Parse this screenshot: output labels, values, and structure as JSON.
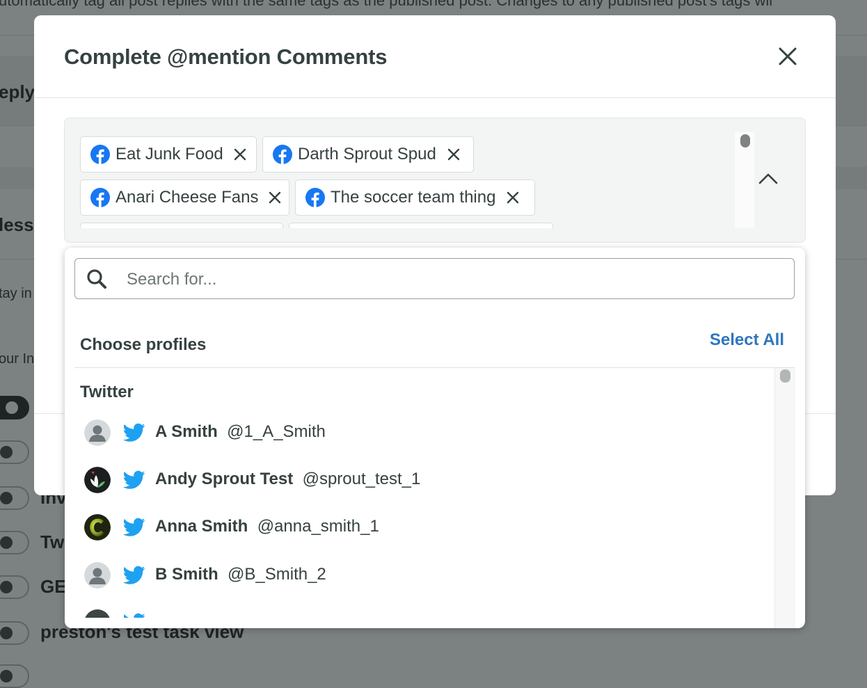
{
  "background": {
    "top_text": "utomatically tag all post replies with the same tags as the published post. Changes to any published post's tags wil",
    "heading_reply": "eply",
    "heading_less": "less",
    "text_stay": "tay in",
    "text_your": "our In",
    "rows": [
      "Inv",
      "Tw",
      "GE",
      "preston's test task view"
    ]
  },
  "modal": {
    "title": "Complete @mention Comments",
    "selected_profiles": [
      {
        "label": "Eat Junk Food",
        "network": "facebook"
      },
      {
        "label": "Darth Sprout Spud",
        "network": "facebook"
      },
      {
        "label": "Anari Cheese Fans",
        "network": "facebook"
      },
      {
        "label": "The soccer team thing",
        "network": "facebook"
      }
    ]
  },
  "dropdown": {
    "search_placeholder": "Search for...",
    "choose_label": "Choose profiles",
    "select_all_label": "Select All",
    "groups": [
      {
        "title": "Twitter",
        "items": [
          {
            "name": "A Smith",
            "handle": "@1_A_Smith",
            "avatar": "default-avatar"
          },
          {
            "name": "Andy Sprout Test",
            "handle": "@sprout_test_1",
            "avatar": "sprout-logo-avatar"
          },
          {
            "name": "Anna Smith",
            "handle": "@anna_smith_1",
            "avatar": "letter-c-avatar"
          },
          {
            "name": "B Smith",
            "handle": "@B_Smith_2",
            "avatar": "default-avatar"
          }
        ]
      }
    ]
  },
  "colors": {
    "overlay": "#7c8181",
    "text": "#364141",
    "link": "#2f76bd",
    "facebook": "#1877f2",
    "twitter": "#1da1f2"
  }
}
